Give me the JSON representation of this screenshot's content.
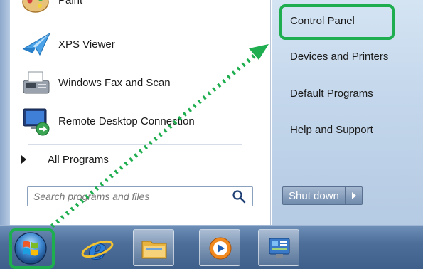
{
  "programs": [
    {
      "label": "Paint",
      "icon": "paint-icon"
    },
    {
      "label": "XPS Viewer",
      "icon": "xps-viewer-icon"
    },
    {
      "label": "Windows Fax and Scan",
      "icon": "fax-scan-icon"
    },
    {
      "label": "Remote Desktop Connection",
      "icon": "remote-desktop-icon"
    }
  ],
  "all_programs": "All Programs",
  "search": {
    "placeholder": "Search programs and files"
  },
  "right_items": [
    "Control Panel",
    "Devices and Printers",
    "Default Programs",
    "Help and Support"
  ],
  "shutdown": {
    "label": "Shut down"
  },
  "taskbar": {
    "start": "windows-start-orb-icon",
    "pinned": [
      "internet-explorer-icon",
      "windows-explorer-icon",
      "media-player-icon",
      "control-panel-icon"
    ]
  },
  "annotation": {
    "highlight_color": "#1fae4f"
  }
}
